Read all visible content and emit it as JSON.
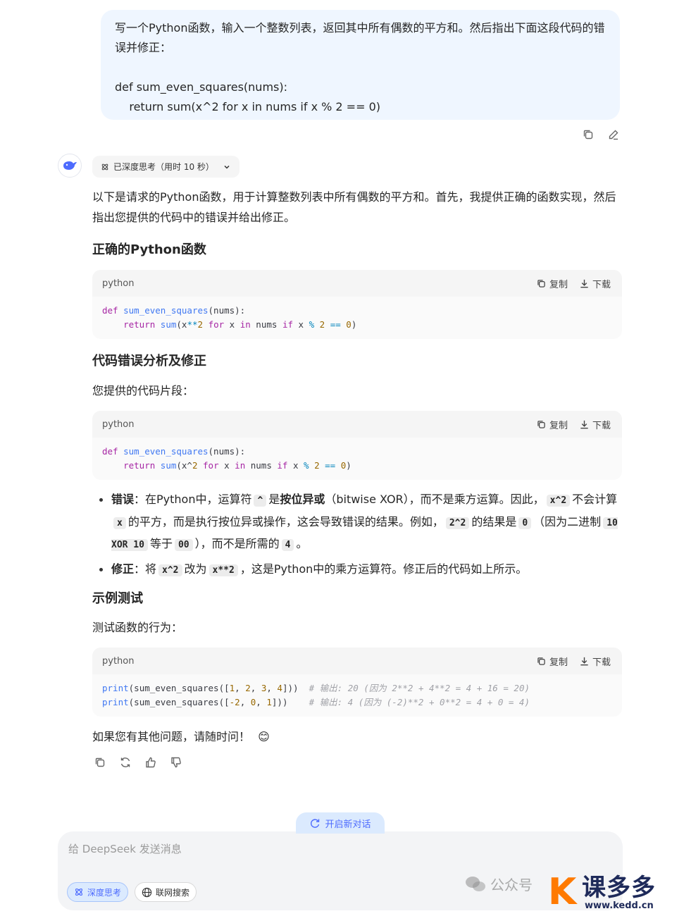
{
  "user_message": {
    "line1": "写一个Python函数，输入一个整数列表，返回其中所有偶数的平方和。然后指出下面这段代码的错误并修正：",
    "line2": "def sum_even_squares(nums):",
    "line3": "    return sum(x^2 for x in nums if x % 2 == 0)"
  },
  "thinking": {
    "label": "已深度思考（用时 10 秒）"
  },
  "answer": {
    "intro": "以下是请求的Python函数，用于计算整数列表中所有偶数的平方和。首先，我提供正确的函数实现，然后指出您提供的代码中的错误并给出修正。",
    "heading1": "正确的Python函数",
    "heading2": "代码错误分析及修正",
    "snippet_intro": "您提供的代码片段：",
    "heading3": "示例测试",
    "test_intro": "测试函数的行为：",
    "outro": "如果您有其他问题，请随时问！",
    "outro_emoji": "😊"
  },
  "code_common": {
    "lang": "python",
    "copy": "复制",
    "download": "下载"
  },
  "code1": {
    "l1": {
      "kw": "def",
      "fn": "sum_even_squares",
      "rest": "(nums):"
    },
    "l2": {
      "kw1": "return",
      "fn": "sum",
      "a": "(x",
      "op1": "**",
      "n1": "2",
      "kw2": "for",
      "b": " x ",
      "kw3": "in",
      "c": " nums ",
      "kw4": "if",
      "d": " x ",
      "op2": "%",
      "n2": "2",
      "op3": "==",
      "n3": "0",
      "e": ")"
    }
  },
  "code2": {
    "l1": {
      "kw": "def",
      "fn": "sum_even_squares",
      "rest": "(nums):"
    },
    "l2": {
      "kw1": "return",
      "fn": "sum",
      "a": "(x^",
      "n1": "2",
      "kw2": "for",
      "b": " x ",
      "kw3": "in",
      "c": " nums ",
      "kw4": "if",
      "d": " x ",
      "op2": "%",
      "n2": "2",
      "op3": "==",
      "n3": "0",
      "e": ")"
    }
  },
  "code3": {
    "l1": {
      "fn": "print",
      "a": "(sum_even_squares([",
      "n1": "1",
      "n2": "2",
      "n3": "3",
      "n4": "4",
      "b": "]))",
      "cm": "# 输出: 20 (因为 2**2 + 4**2 = 4 + 16 = 20)"
    },
    "l2": {
      "fn": "print",
      "a": "(sum_even_squares([",
      "n1": "-2",
      "n2": "0",
      "n3": "1",
      "b": "]))",
      "cm": "# 输出: 4 (因为 (-2)**2 + 0**2 = 4 + 0 = 4)"
    }
  },
  "bullets": {
    "b1": {
      "label": "错误",
      "t1": "：在Python中，运算符",
      "c1": "^",
      "t2": "是",
      "bold": "按位异或",
      "t3": "（bitwise XOR），而不是乘方运算。因此，",
      "c2": "x^2",
      "t4": "不会计算",
      "c3": "x",
      "t5": "的平方，而是执行按位异或操作，这会导致错误的结果。例如，",
      "c4": "2^2",
      "t6": "的结果是",
      "c5": "0",
      "t7": "（因为二进制",
      "c6": "10 XOR 10",
      "t8": "等于",
      "c7": "00",
      "t9": "），而不是所需的",
      "c8": "4",
      "t10": "。"
    },
    "b2": {
      "label": "修正",
      "t1": "：将",
      "c1": "x^2",
      "t2": "改为",
      "c2": "x**2",
      "t3": "，这是Python中的乘方运算符。修正后的代码如上所示。"
    }
  },
  "new_chat": {
    "label": "开启新对话"
  },
  "composer": {
    "placeholder": "给 DeepSeek 发送消息",
    "deep_think": "深度思考",
    "web_search": "联网搜索"
  },
  "watermark": {
    "text": "公众号",
    "brand_letter": "K",
    "brand_name": "课多多",
    "brand_url": "www.kedd.cn"
  },
  "colors": {
    "accent": "#4d6bfe",
    "user_bubble": "#eff6ff",
    "brand_orange": "#ff7a00",
    "brand_navy": "#1e2a5a"
  },
  "icons": [
    "copy-icon",
    "edit-icon",
    "deepseek-whale-icon",
    "atom-icon",
    "chevron-down-icon",
    "download-icon",
    "regenerate-icon",
    "thumbs-up-icon",
    "thumbs-down-icon",
    "new-chat-icon",
    "globe-icon",
    "wechat-icon"
  ]
}
